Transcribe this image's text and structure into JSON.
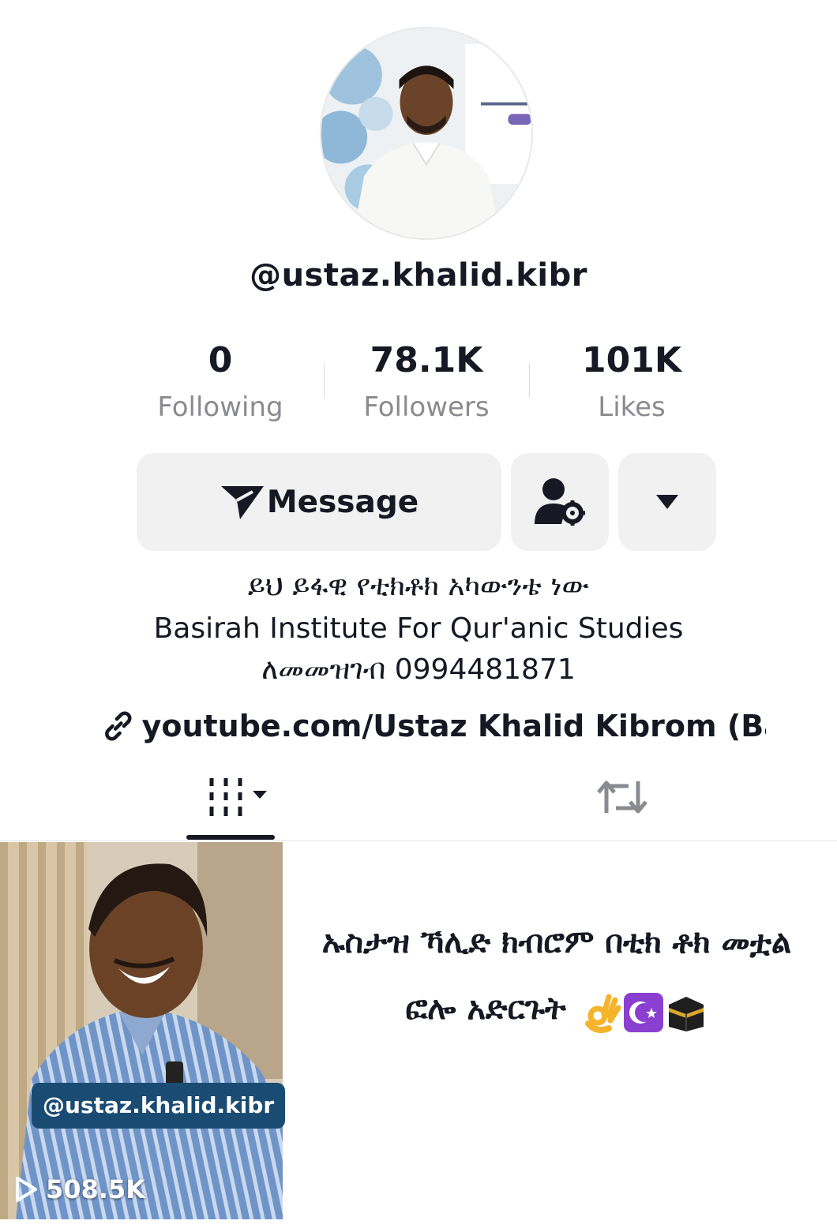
{
  "profile": {
    "username": "@ustaz.khalid.kibr",
    "stats": [
      {
        "value": "0",
        "label": "Following"
      },
      {
        "value": "78.1K",
        "label": "Followers"
      },
      {
        "value": "101K",
        "label": "Likes"
      }
    ],
    "actions": {
      "message_label": "Message",
      "message_icon": "send-icon",
      "person_icon": "person-settings-icon",
      "more_icon": "caret-down-icon"
    },
    "bio": {
      "line1": "ይህ ይፋዊ የቲክቶክ አካውንቴ ነው",
      "line2": "Basirah Institute For Qur'anic Studies",
      "line3": "ለመመዝገብ 0994481871"
    },
    "link": {
      "icon": "link-icon",
      "text": "youtube.com/Ustaz Khalid Kibrom (Bas..."
    }
  },
  "tabs": [
    {
      "name": "videos",
      "icon": "grid-icon",
      "active": true
    },
    {
      "name": "reposts",
      "icon": "repost-icon",
      "active": false
    }
  ],
  "videos": [
    {
      "overlay_tag": "@ustaz.khalid.kibr",
      "views": "508.5K",
      "views_icon": "play-icon",
      "caption": "ኡስታዝ ኻሊድ ክብሮም በቲክ ቶክ መቷል ፎሎ አድርጉት",
      "caption_emojis": [
        "ok-hand-emoji",
        "star-crescent-emoji",
        "kaaba-emoji"
      ]
    }
  ],
  "colors": {
    "text": "#161823",
    "secondary_text": "#8a8b91",
    "button_bg": "#f1f1f2",
    "tag_bg": "#1a4b73"
  }
}
